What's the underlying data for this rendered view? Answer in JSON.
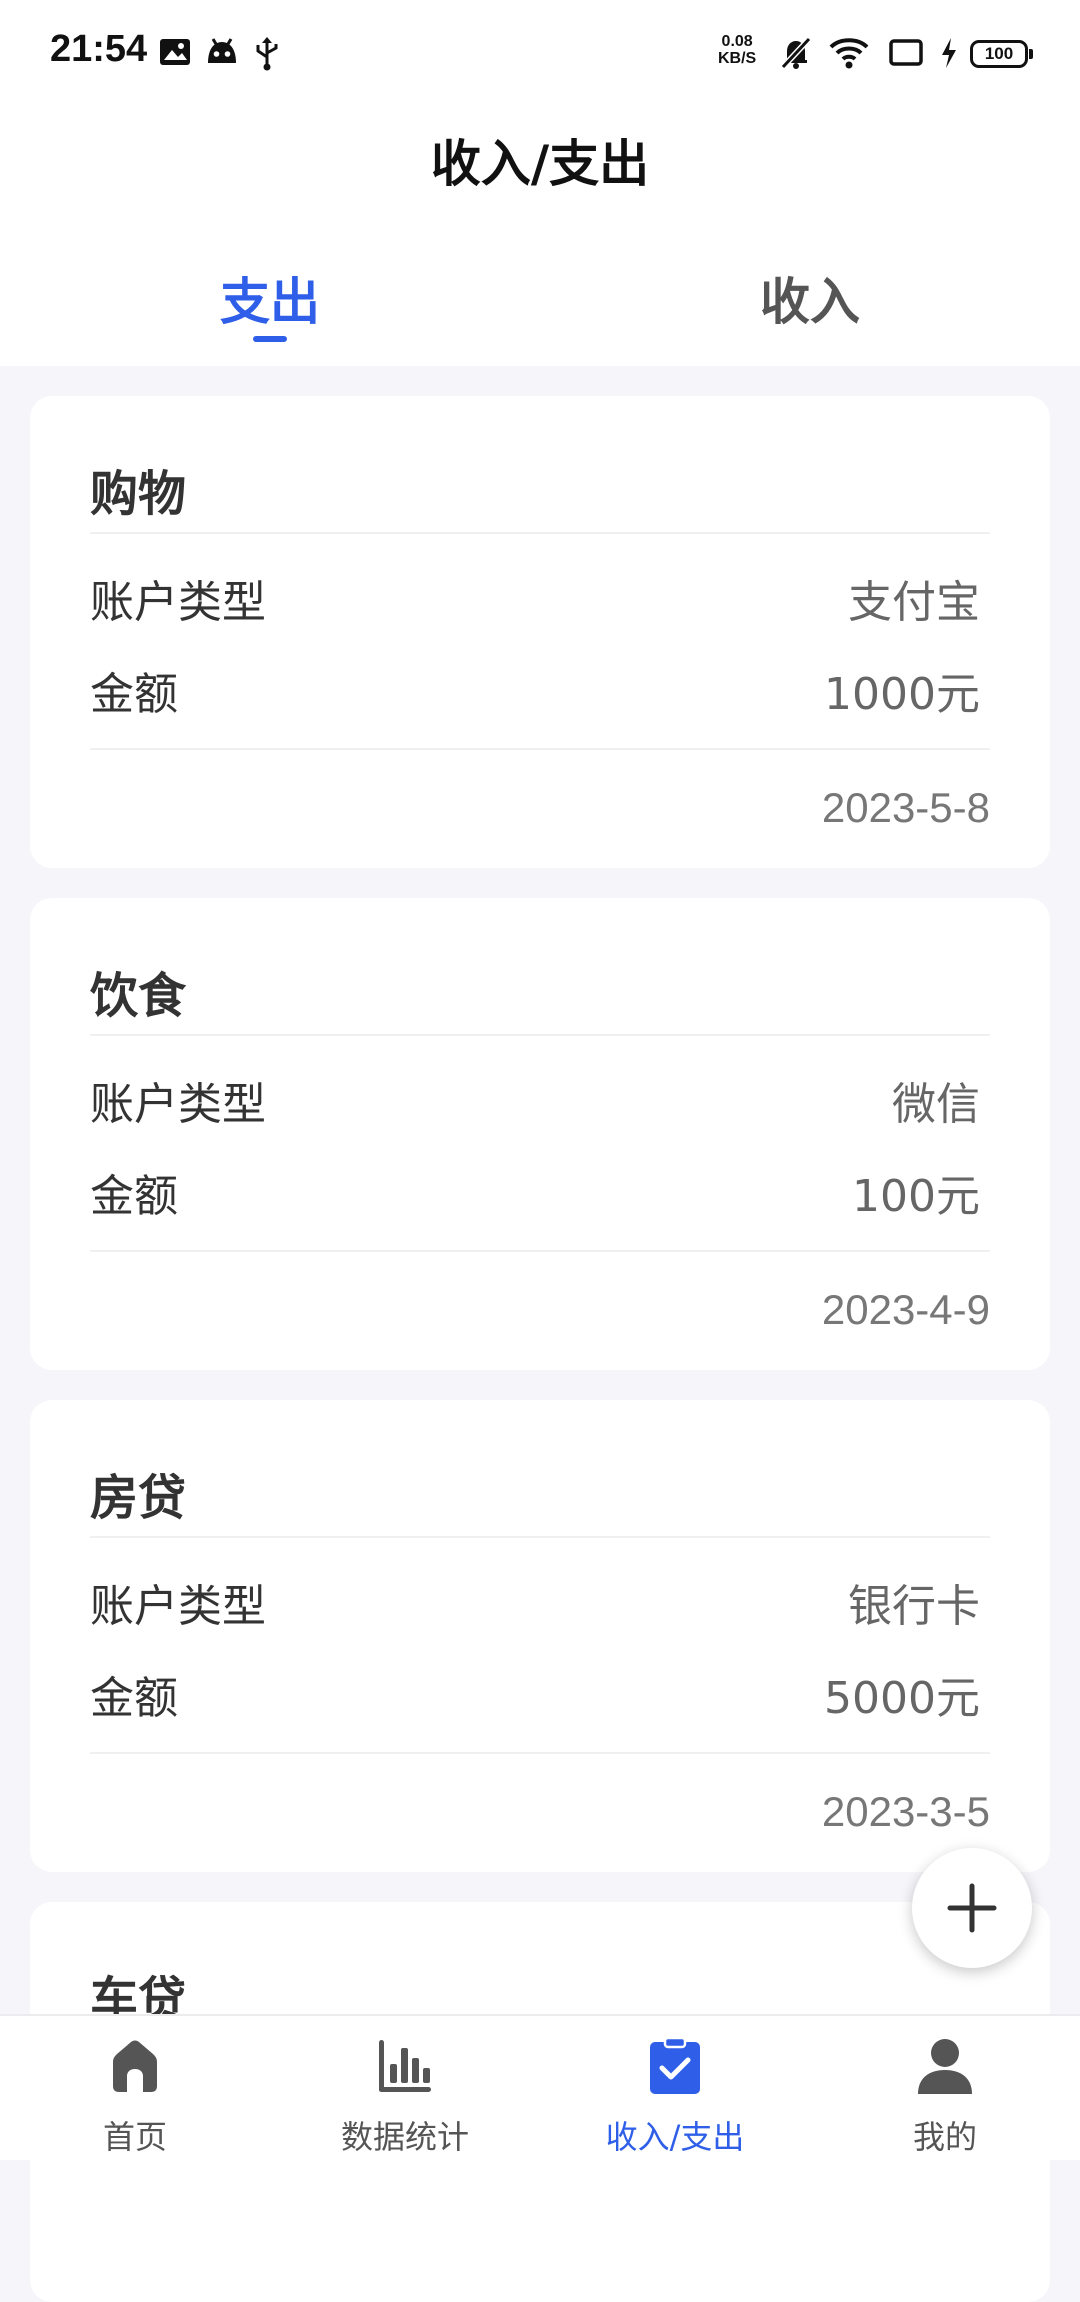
{
  "status_bar": {
    "time": "21:54",
    "net_speed_value": "0.08",
    "net_speed_unit": "KB/S",
    "battery": "100",
    "icons": [
      "image-icon",
      "android-icon",
      "usb-icon",
      "mute-icon",
      "wifi-icon",
      "screen-icon",
      "charging-icon"
    ]
  },
  "header": {
    "title": "收入/支出"
  },
  "tabs": [
    {
      "label": "支出",
      "active": true
    },
    {
      "label": "收入",
      "active": false
    }
  ],
  "records": [
    {
      "title": "购物",
      "account_label": "账户类型",
      "account_value": "支付宝",
      "amount_label": "金额",
      "amount_value": "1000元",
      "date": "2023-5-8"
    },
    {
      "title": "饮食",
      "account_label": "账户类型",
      "account_value": "微信",
      "amount_label": "金额",
      "amount_value": "100元",
      "date": "2023-4-9"
    },
    {
      "title": "房贷",
      "account_label": "账户类型",
      "account_value": "银行卡",
      "amount_label": "金额",
      "amount_value": "5000元",
      "date": "2023-3-5"
    },
    {
      "title": "车贷"
    }
  ],
  "fab": {
    "icon": "plus-icon"
  },
  "nav": [
    {
      "label": "首页",
      "icon": "home-icon",
      "active": false
    },
    {
      "label": "数据统计",
      "icon": "bar-chart-icon",
      "active": false
    },
    {
      "label": "收入/支出",
      "icon": "clipboard-check-icon",
      "active": true
    },
    {
      "label": "我的",
      "icon": "user-icon",
      "active": false
    }
  ],
  "colors": {
    "accent": "#2f5fe8",
    "page_bg": "#f6f6fa",
    "card_bg": "#ffffff",
    "nav_icon_inactive": "#555555"
  }
}
